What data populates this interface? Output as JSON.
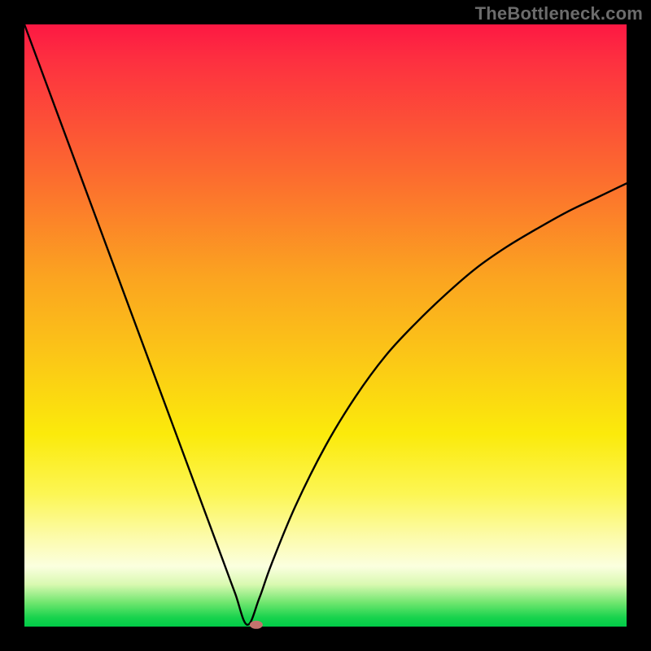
{
  "watermark": "TheBottleneck.com",
  "chart_data": {
    "type": "line",
    "title": "",
    "xlabel": "",
    "ylabel": "",
    "xlim": [
      0,
      100
    ],
    "ylim": [
      0,
      100
    ],
    "background_gradient": {
      "orientation": "vertical",
      "stops": [
        {
          "pct": 0,
          "color": "#fd1843"
        },
        {
          "pct": 25,
          "color": "#fc6b2f"
        },
        {
          "pct": 55,
          "color": "#fbc617"
        },
        {
          "pct": 78,
          "color": "#fcf654"
        },
        {
          "pct": 90,
          "color": "#fbffdf"
        },
        {
          "pct": 100,
          "color": "#00cc48"
        }
      ]
    },
    "series": [
      {
        "name": "bottleneck-curve",
        "description": "V-shaped curve; minimum (optimum) near x≈37",
        "x": [
          0,
          5,
          10,
          15,
          20,
          25,
          30,
          33,
          35,
          37,
          39,
          41,
          45,
          50,
          55,
          60,
          65,
          70,
          75,
          80,
          85,
          90,
          95,
          100
        ],
        "y": [
          100,
          86.5,
          73,
          59.5,
          46,
          32.5,
          19,
          10.9,
          5.5,
          0.3,
          4.7,
          10.3,
          20,
          30,
          38.2,
          45,
          50.4,
          55.2,
          59.5,
          63,
          66,
          68.8,
          71.2,
          73.6
        ]
      }
    ],
    "marker": {
      "x": 38.5,
      "y": 0.3,
      "shape": "capsule",
      "color": "#c4736d"
    }
  }
}
